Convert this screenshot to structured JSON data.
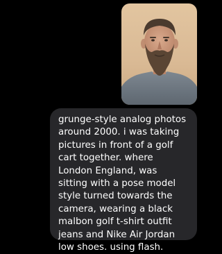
{
  "message": {
    "attachment_icon": "portrait-photo",
    "text": "grunge-style analog photos around 2000. i was taking pictures in front of a golf cart together. where London England, was sitting with a pose model style turned towards the camera, wearing a black malbon golf t-shirt outfit jeans and Nike Air Jordan low shoes. using flash."
  },
  "colors": {
    "background": "#000000",
    "bubble": "#27272a",
    "text": "#ffffff"
  }
}
